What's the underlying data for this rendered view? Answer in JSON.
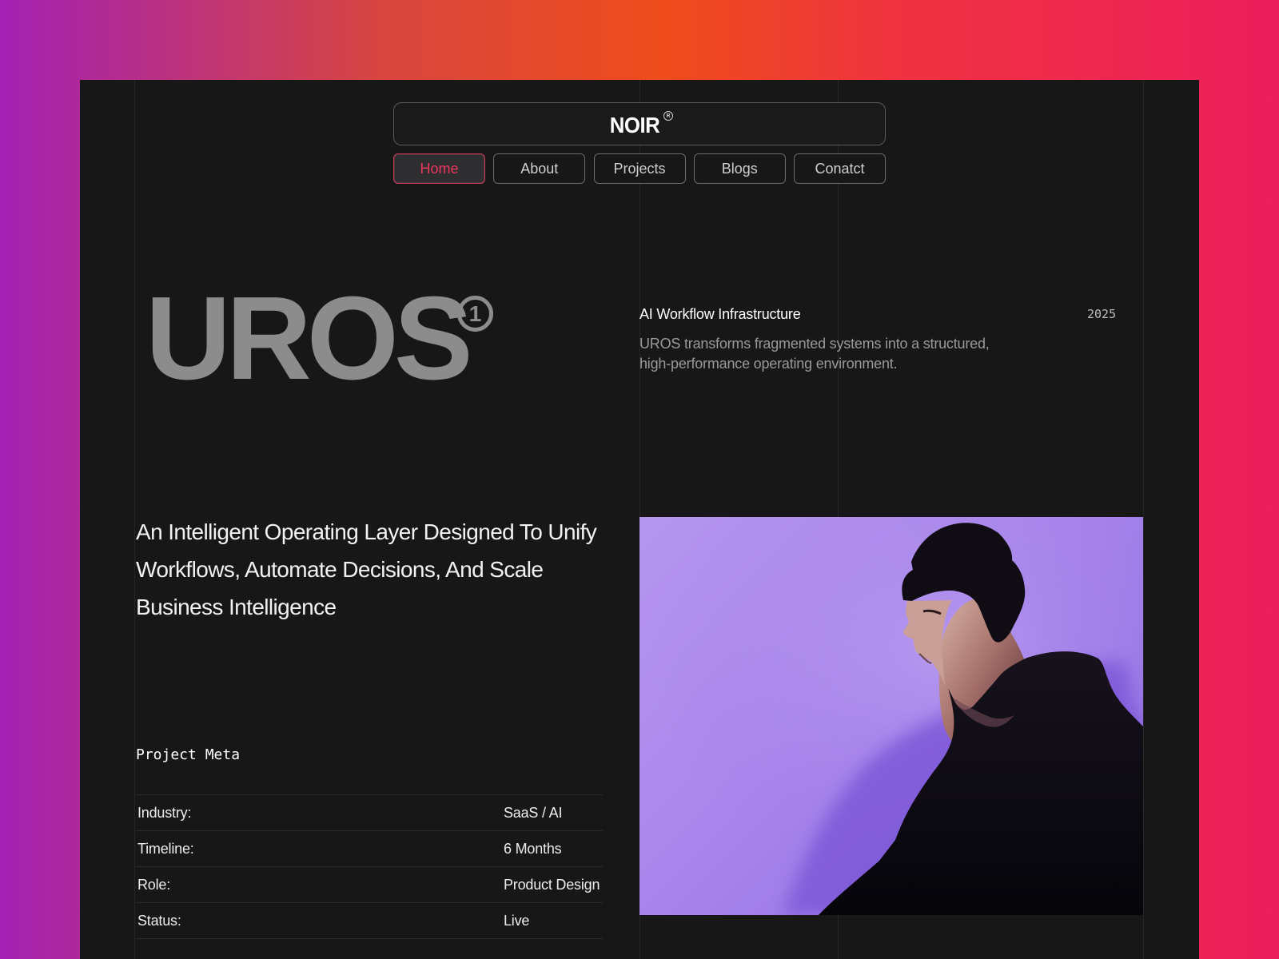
{
  "brand": {
    "name": "NOIR",
    "mark": "R"
  },
  "nav": [
    {
      "label": "Home",
      "active": true
    },
    {
      "label": "About",
      "active": false
    },
    {
      "label": "Projects",
      "active": false
    },
    {
      "label": "Blogs",
      "active": false
    },
    {
      "label": "Conatct",
      "active": false
    }
  ],
  "hero": {
    "title": "UROS",
    "badge": "1",
    "subtitle": "AI Workflow Infrastructure",
    "year": "2025",
    "description": "UROS transforms fragmented systems into a structured, high-performance operating environment.",
    "tagline": "An Intelligent Operating Layer Designed To Unify Workflows, Automate Decisions, And Scale Business Intelligence"
  },
  "project_meta": {
    "title": "Project Meta",
    "rows": [
      {
        "label": "Industry:",
        "value": "SaaS / AI"
      },
      {
        "label": "Timeline:",
        "value": "6 Months"
      },
      {
        "label": "Role:",
        "value": "Product Design"
      },
      {
        "label": "Status:",
        "value": "Live"
      }
    ]
  },
  "colors": {
    "accent": "#f0365c",
    "page_bg": "#171717",
    "portrait_bg": "#aa87ec"
  }
}
